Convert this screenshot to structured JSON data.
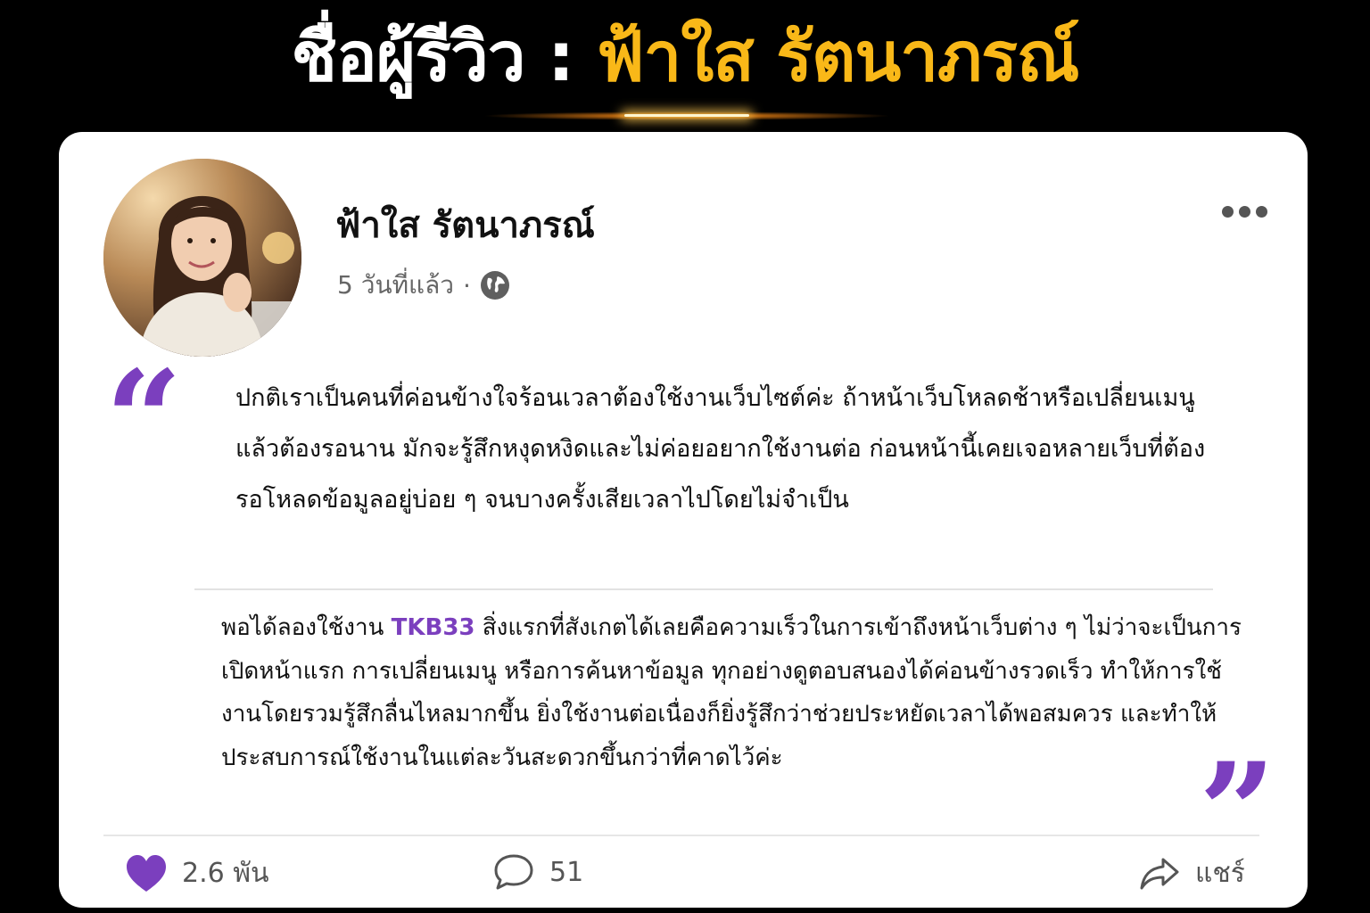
{
  "header": {
    "label": "ชื่อผู้รีวิว",
    "separator": " : ",
    "name": "ฟ้าใส รัตนาภรณ์"
  },
  "post": {
    "author": "ฟ้าใส รัตนาภรณ์",
    "time": "5 วันที่แล้ว",
    "dot": "·",
    "visibility_icon": "globe-icon",
    "menu_icon": "more-icon",
    "quote_open": "“",
    "quote_close": "”",
    "paragraph1": "ปกติเราเป็นคนที่ค่อนข้างใจร้อนเวลาต้องใช้งานเว็บไซต์ค่ะ ถ้าหน้าเว็บโหลดช้าหรือเปลี่ยนเมนูแล้วต้องรอนาน มักจะรู้สึกหงุดหงิดและไม่ค่อยอยากใช้งานต่อ ก่อนหน้านี้เคยเจอหลายเว็บที่ต้องรอโหลดข้อมูลอยู่บ่อย ๆ จนบางครั้งเสียเวลาไปโดยไม่จำเป็น",
    "paragraph2_pre": "พอได้ลองใช้งาน ",
    "brand": "TKB33",
    "paragraph2_post": " สิ่งแรกที่สังเกตได้เลยคือความเร็วในการเข้าถึงหน้าเว็บต่าง ๆ ไม่ว่าจะเป็นการเปิดหน้าแรก การเปลี่ยนเมนู หรือการค้นหาข้อมูล ทุกอย่างดูตอบสนองได้ค่อนข้างรวดเร็ว ทำให้การใช้งานโดยรวมรู้สึกลื่นไหลมากขึ้น ยิ่งใช้งานต่อเนื่องก็ยิ่งรู้สึกว่าช่วยประหยัดเวลาได้พอสมควร และทำให้ประสบการณ์ใช้งานในแต่ละวันสะดวกขึ้นกว่าที่คาดไว้ค่ะ"
  },
  "actions": {
    "likes": "2.6 พัน",
    "comments": "51",
    "share": "แชร์"
  },
  "colors": {
    "accent": "#7b3fbe",
    "header_name": "#f9b818",
    "background": "#000000",
    "card": "#ffffff"
  }
}
